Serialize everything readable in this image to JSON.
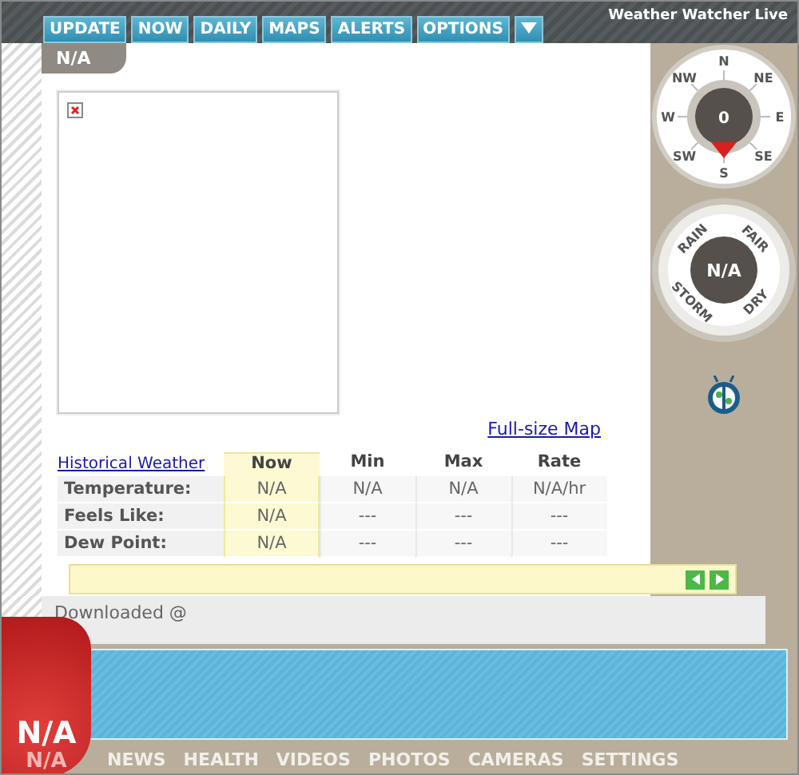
{
  "title": "Weather Watcher Live",
  "tabs": [
    {
      "label": "UPDATE"
    },
    {
      "label": "NOW"
    },
    {
      "label": "DAILY"
    },
    {
      "label": "MAPS"
    },
    {
      "label": "ALERTS"
    },
    {
      "label": "OPTIONS"
    }
  ],
  "location": "N/A",
  "map": {
    "link": "Full-size Map"
  },
  "table": {
    "link": "Historical Weather",
    "columns": [
      {
        "label": "Now",
        "selected": true
      },
      {
        "label": "Min",
        "selected": false
      },
      {
        "label": "Max",
        "selected": false
      },
      {
        "label": "Rate",
        "selected": false
      }
    ],
    "rows": [
      {
        "label": "Temperature:",
        "cells": [
          "N/A",
          "N/A",
          "N/A",
          "N/A/hr"
        ]
      },
      {
        "label": "Feels Like:",
        "cells": [
          "N/A",
          "---",
          "---",
          "---"
        ]
      },
      {
        "label": "Dew Point:",
        "cells": [
          "N/A",
          "---",
          "---",
          "---"
        ]
      }
    ]
  },
  "wind": {
    "directions": [
      "N",
      "NE",
      "E",
      "SE",
      "S",
      "SW",
      "W",
      "NW"
    ],
    "speed": "0"
  },
  "forecast": {
    "labels": [
      "RAIN",
      "FAIR",
      "DRY",
      "STORM"
    ],
    "value": "N/A"
  },
  "footer": "Downloaded @",
  "temperature": {
    "main": "N/A",
    "sub": "N/A"
  },
  "nav": [
    "NEWS",
    "HEALTH",
    "VIDEOS",
    "PHOTOS",
    "CAMERAS",
    "SETTINGS"
  ]
}
